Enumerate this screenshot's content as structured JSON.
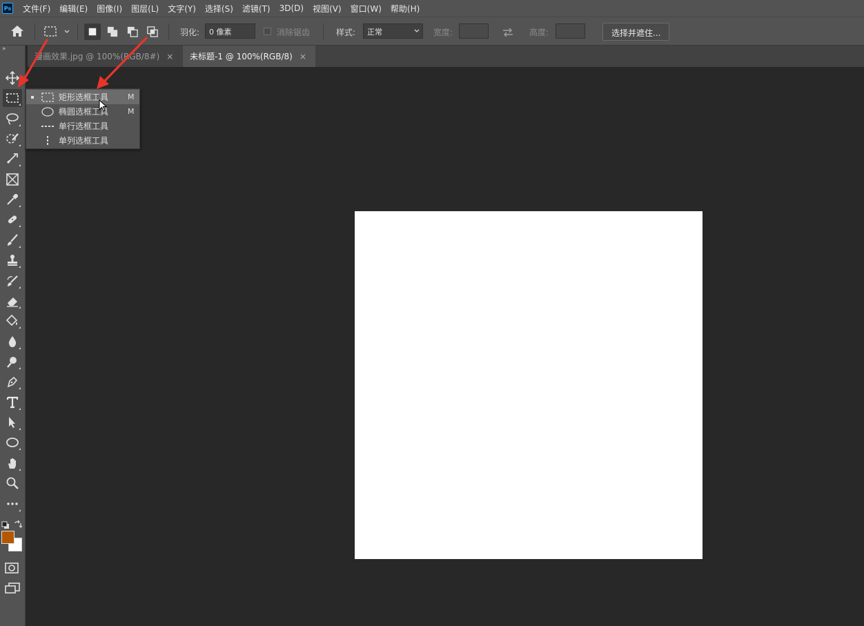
{
  "app": {
    "logo_text": "Ps"
  },
  "menu": [
    "文件(F)",
    "编辑(E)",
    "图像(I)",
    "图层(L)",
    "文字(Y)",
    "选择(S)",
    "滤镜(T)",
    "3D(D)",
    "视图(V)",
    "窗口(W)",
    "帮助(H)"
  ],
  "options": {
    "feather_label": "羽化:",
    "feather_value": "0 像素",
    "antialias_label": "消除锯齿",
    "style_label": "样式:",
    "style_value": "正常",
    "width_label": "宽度:",
    "height_label": "高度:",
    "select_mask_button": "选择并遮住..."
  },
  "tabs": [
    {
      "label": "漫画效果.jpg @ 100%(RGB/8#)",
      "active": false
    },
    {
      "label": "未标题-1 @ 100%(RGB/8)",
      "active": true
    }
  ],
  "tab_close_glyph": "×",
  "toolbar": {
    "collapse_glyph": "»",
    "foreground_color": "#b35800",
    "background_color": "#ffffff"
  },
  "flyout": {
    "items": [
      {
        "label": "矩形选框工具",
        "shortcut": "M",
        "icon": "rect-marquee-icon",
        "selected": true
      },
      {
        "label": "椭圆选框工具",
        "shortcut": "M",
        "icon": "ellipse-marquee-icon",
        "selected": false
      },
      {
        "label": "单行选框工具",
        "shortcut": "",
        "icon": "single-row-marquee-icon",
        "selected": false
      },
      {
        "label": "单列选框工具",
        "shortcut": "",
        "icon": "single-column-marquee-icon",
        "selected": false
      }
    ]
  },
  "annotation_color": "#e8352b"
}
